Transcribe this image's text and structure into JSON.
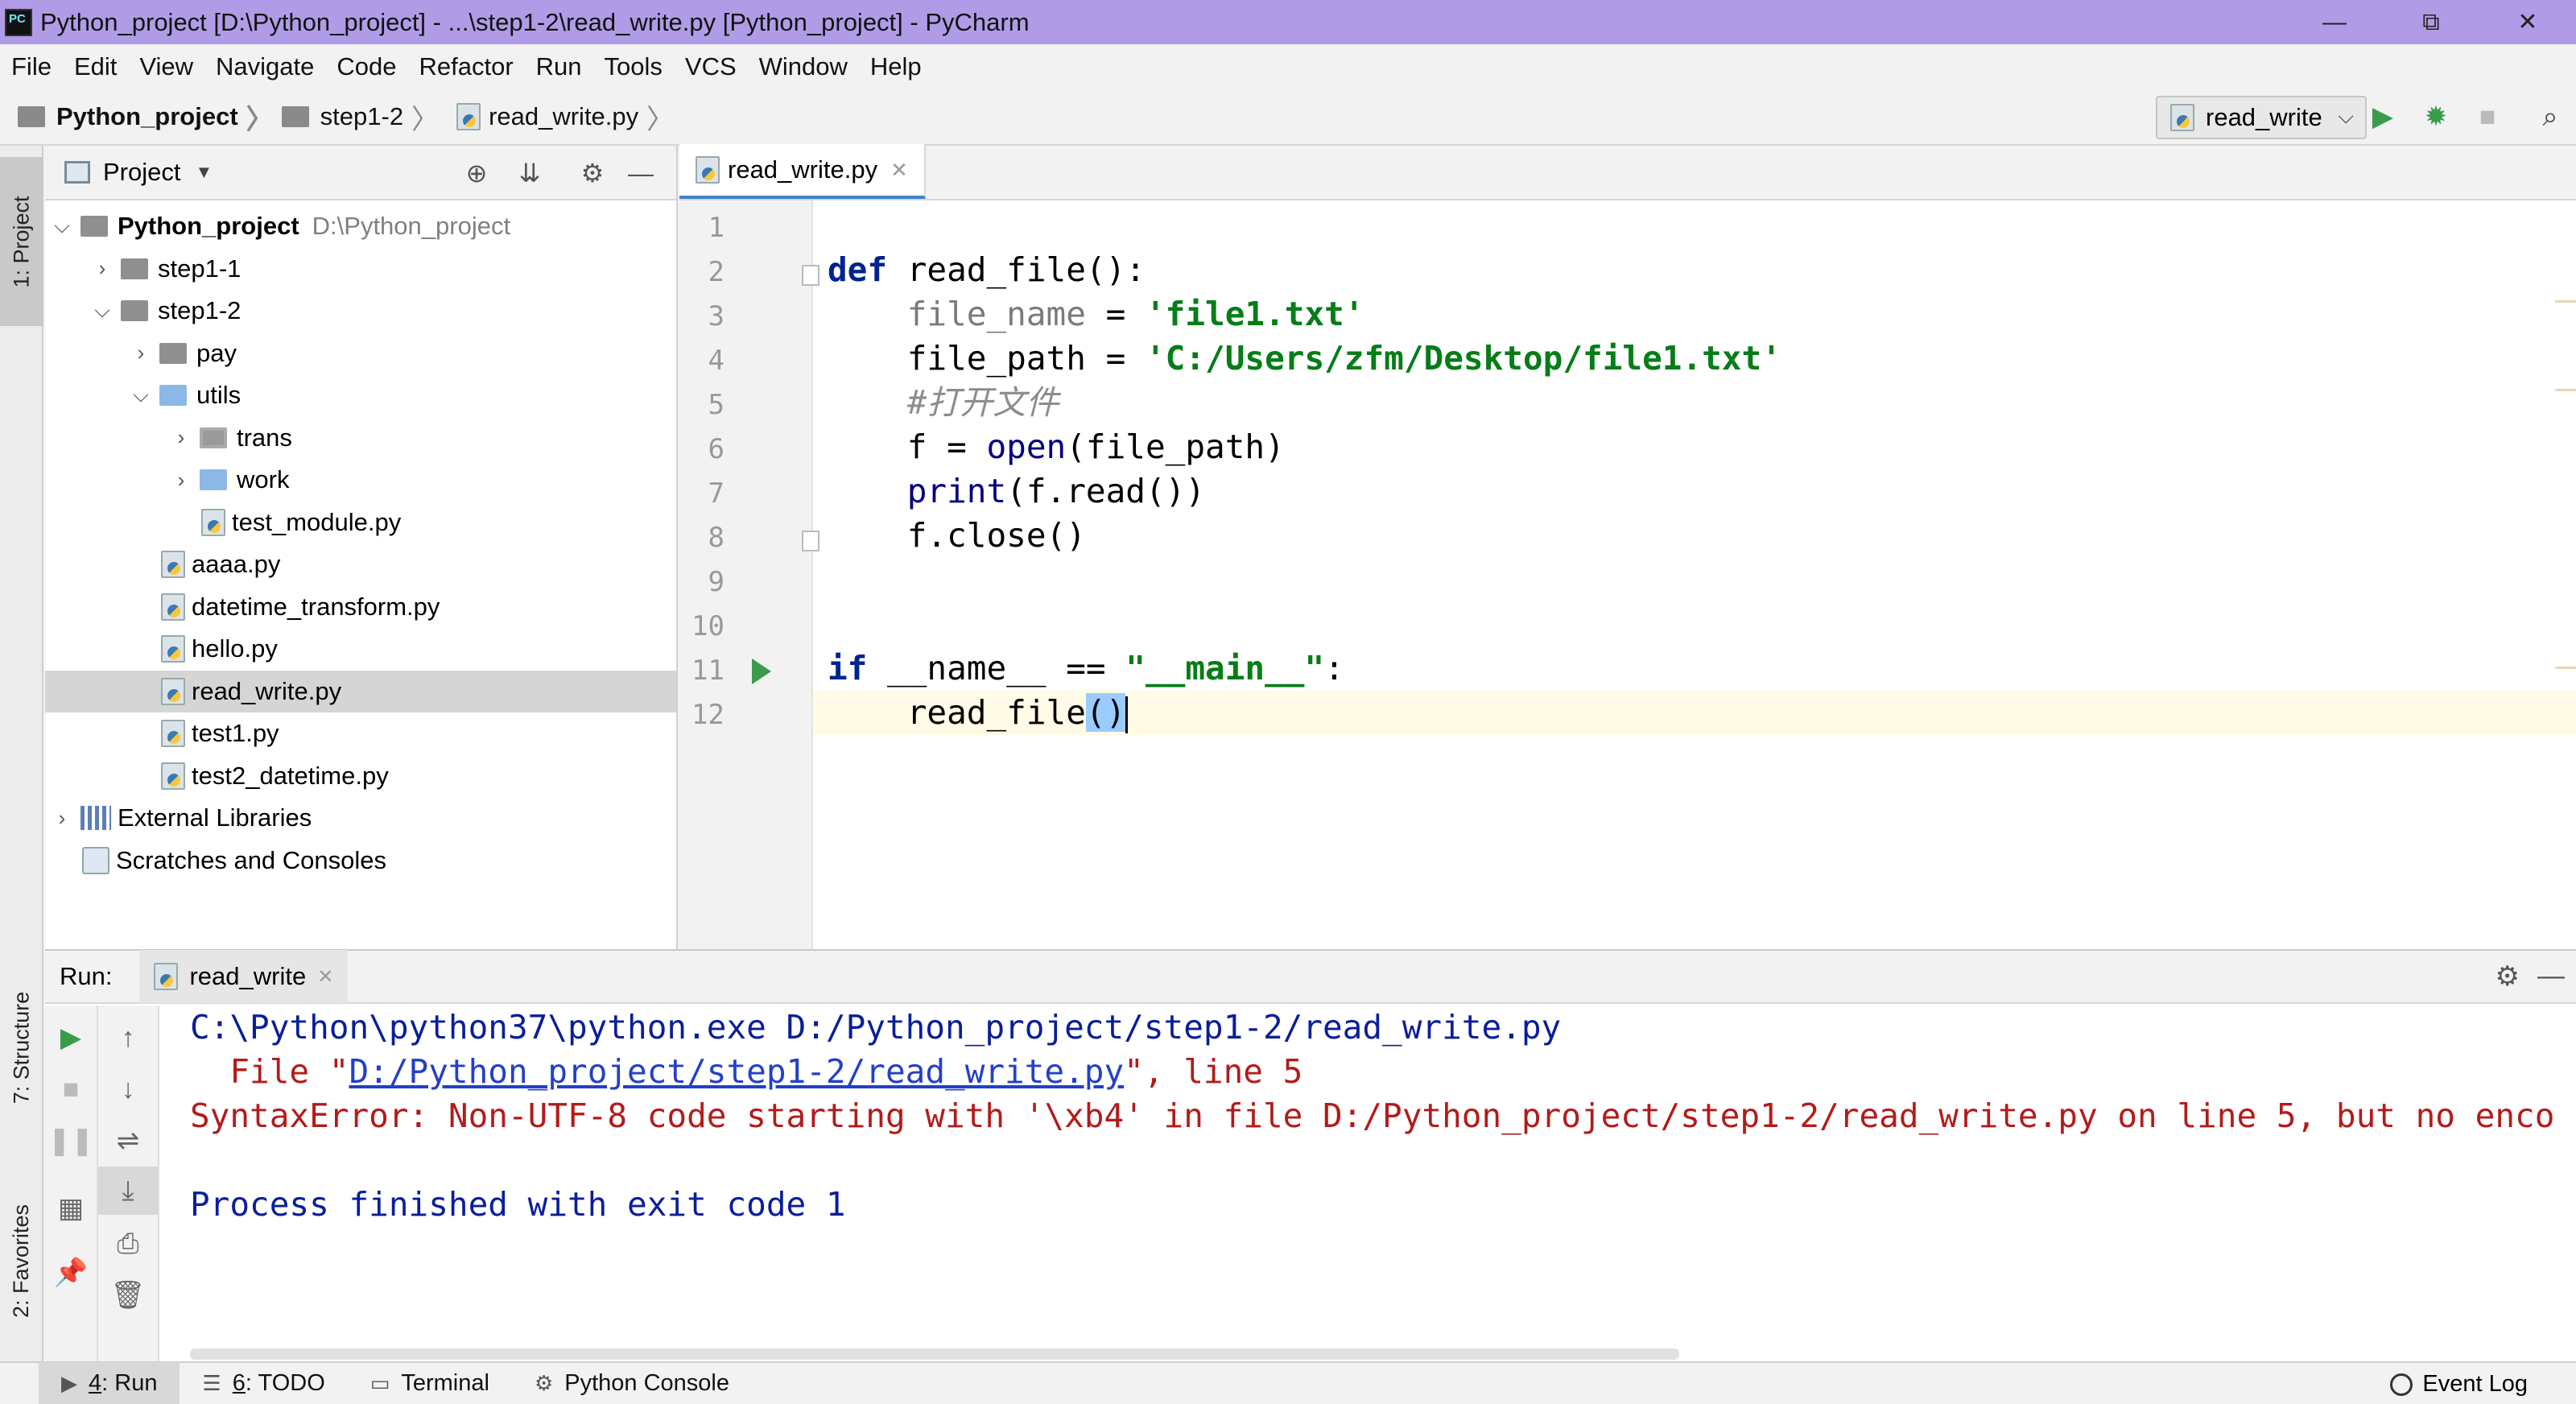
{
  "window": {
    "title": "Python_project [D:\\Python_project] - ...\\step1-2\\read_write.py [Python_project] - PyCharm",
    "app_icon": "PC",
    "controls": [
      "—",
      "⧉",
      "✕"
    ]
  },
  "menu": [
    "File",
    "Edit",
    "View",
    "Navigate",
    "Code",
    "Refactor",
    "Run",
    "Tools",
    "VCS",
    "Window",
    "Help"
  ],
  "breadcrumb": [
    "Python_project",
    "step1-2",
    "read_write.py"
  ],
  "run_config": "read_write",
  "left_strip": {
    "project": "1: Project",
    "structure": "7: Structure",
    "favorites": "2: Favorites"
  },
  "project_panel": {
    "title": "Project",
    "tree": [
      {
        "label": "Python_project",
        "path": "D:\\Python_project"
      },
      {
        "label": "step1-1"
      },
      {
        "label": "step1-2"
      },
      {
        "label": "pay"
      },
      {
        "label": "utils"
      },
      {
        "label": "trans"
      },
      {
        "label": "work"
      },
      {
        "label": "test_module.py"
      },
      {
        "label": "aaaa.py"
      },
      {
        "label": "datetime_transform.py"
      },
      {
        "label": "hello.py"
      },
      {
        "label": "read_write.py"
      },
      {
        "label": "test1.py"
      },
      {
        "label": "test2_datetime.py"
      },
      {
        "label": "External Libraries"
      },
      {
        "label": "Scratches and Consoles"
      }
    ]
  },
  "editor": {
    "tab": "read_write.py",
    "line_numbers": [
      "1",
      "2",
      "3",
      "4",
      "5",
      "6",
      "7",
      "8",
      "9",
      "10",
      "11",
      "12"
    ],
    "code": {
      "l2_kw": "def",
      "l2_rest": " read_file():",
      "l3_var": "file_name",
      "l3_eq": " = ",
      "l3_str": "'file1.txt'",
      "l4_var": "file_path = ",
      "l4_str": "'C:/Users/zfm/Desktop/file1.txt'",
      "l5_comment": "#打开文件",
      "l6_a": "f = ",
      "l6_fn": "open",
      "l6_b": "(file_path)",
      "l7_fn": "print",
      "l7_b": "(f.read())",
      "l8": "f.close()",
      "l11_kw": "if",
      "l11_a": " __name__ == ",
      "l11_str": "\"__main__\"",
      "l11_b": ":",
      "l12_a": "read_file",
      "l12_brk": "()"
    }
  },
  "run_panel": {
    "label": "Run:",
    "tab": "read_write",
    "output": {
      "line1": "C:\\Python\\python37\\python.exe D:/Python_project/step1-2/read_write.py",
      "line2_a": "  File \"",
      "line2_link": "D:/Python_project/step1-2/read_write.py",
      "line2_b": "\", line 5",
      "line3": "SyntaxError: Non-UTF-8 code starting with '\\xb4' in file D:/Python_project/step1-2/read_write.py on line 5, but no enco",
      "line5": "Process finished with exit code 1"
    }
  },
  "bottom_tabs": {
    "run_num": "4",
    "run_label": ": Run",
    "todo_num": "6",
    "todo_label": ": TODO",
    "terminal": "Terminal",
    "python_console": "Python Console",
    "event_log": "Event Log"
  }
}
